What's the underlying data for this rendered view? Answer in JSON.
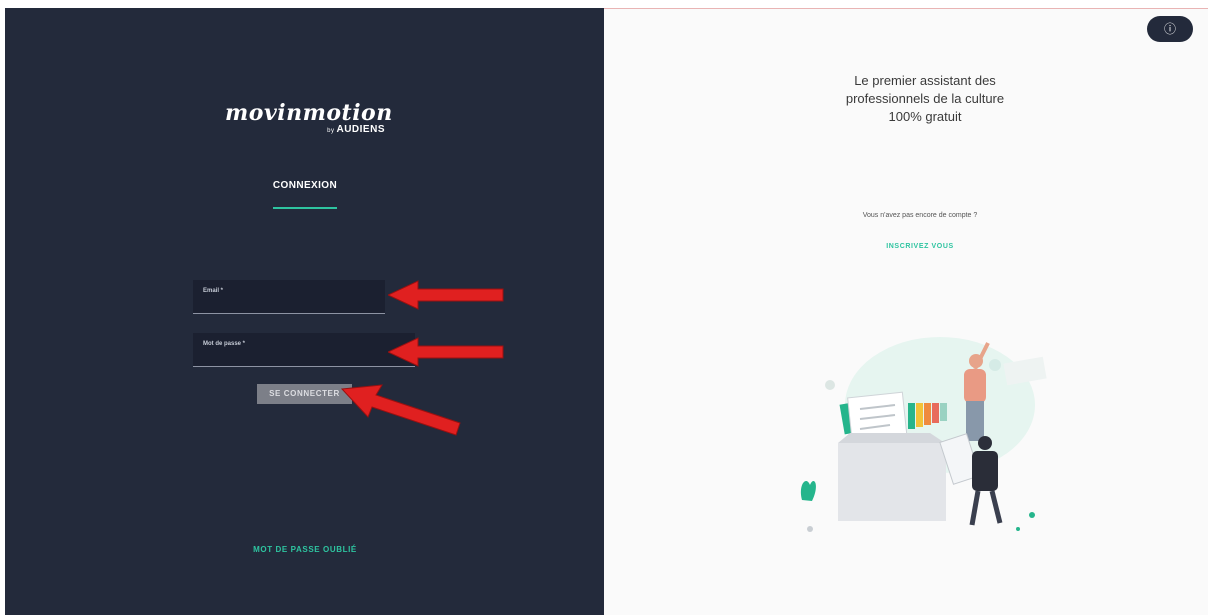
{
  "brand": {
    "name": "movinmotion",
    "by": "by",
    "partner": "AUDIENS"
  },
  "login": {
    "tab_label": "CONNEXION",
    "email_label": "Email *",
    "password_label": "Mot de passe *",
    "submit_label": "SE CONNECTER",
    "forgot_label": "MOT DE PASSE OUBLIÉ"
  },
  "promo": {
    "headline_line1": "Le premier assistant des",
    "headline_line2": "professionnels de la culture",
    "headline_line3": "100% gratuit",
    "no_account": "Vous n'avez pas encore de compte ?",
    "signup_label": "INSCRIVEZ VOUS"
  },
  "help_icon": "question-circle-icon",
  "colors": {
    "dark_panel": "#232a3b",
    "accent": "#2ec4a0",
    "annotation_arrow": "#e02020"
  }
}
